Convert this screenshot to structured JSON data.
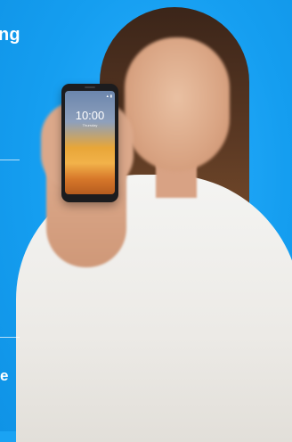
{
  "headline_fragment": "ng",
  "footer_fragment": "e",
  "phone": {
    "time": "10:00",
    "date": "Thursday",
    "status": "▲ ▮"
  },
  "colors": {
    "background": "#1aa3f3",
    "text": "#ffffff"
  }
}
